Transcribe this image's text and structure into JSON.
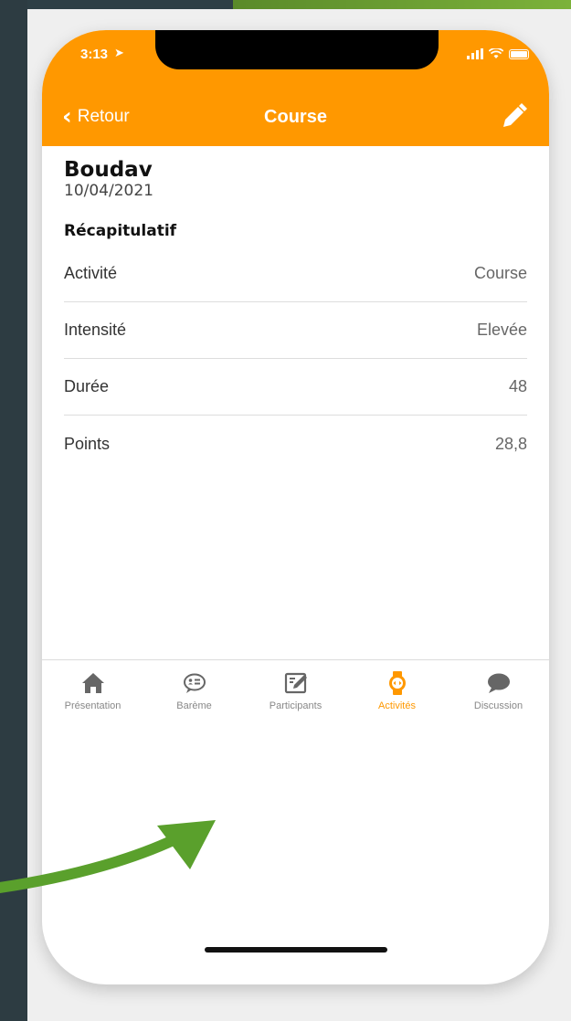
{
  "status_bar": {
    "time": "3:13"
  },
  "nav": {
    "back_label": "Retour",
    "title": "Course"
  },
  "header": {
    "name": "Boudav",
    "date": "10/04/2021"
  },
  "recap": {
    "title": "Récapitulatif",
    "rows": [
      {
        "label": "Activité",
        "value": "Course"
      },
      {
        "label": "Intensité",
        "value": "Elevée"
      },
      {
        "label": "Durée",
        "value": "48"
      },
      {
        "label": "Points",
        "value": "28,8"
      }
    ]
  },
  "tabs": [
    {
      "label": "Présentation",
      "icon": "home-icon"
    },
    {
      "label": "Barème",
      "icon": "chat-list-icon"
    },
    {
      "label": "Participants",
      "icon": "edit-board-icon"
    },
    {
      "label": "Activités",
      "icon": "watch-icon"
    },
    {
      "label": "Discussion",
      "icon": "chat-bubble-icon"
    }
  ],
  "active_tab": "Activités",
  "colors": {
    "accent": "#ff9800",
    "arrow": "#5aa02c",
    "inactive_icon": "#666666"
  }
}
